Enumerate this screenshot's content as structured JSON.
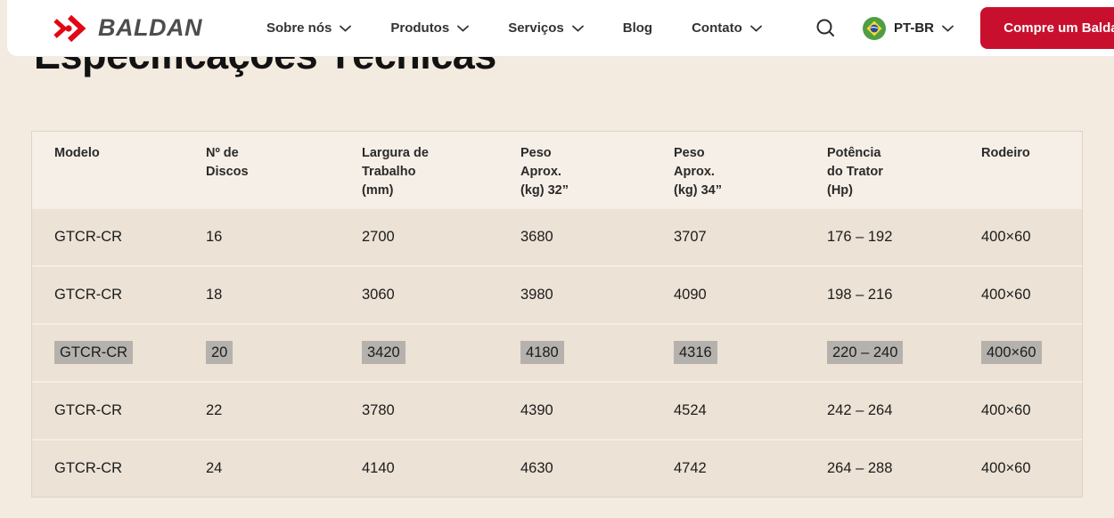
{
  "brand": {
    "name": "BALDAN"
  },
  "nav": {
    "items": [
      {
        "label": "Sobre nós",
        "has_dropdown": true
      },
      {
        "label": "Produtos",
        "has_dropdown": true
      },
      {
        "label": "Serviços",
        "has_dropdown": true
      },
      {
        "label": "Blog",
        "has_dropdown": false
      },
      {
        "label": "Contato",
        "has_dropdown": true
      }
    ]
  },
  "header_actions": {
    "language": "PT-BR",
    "cta_label": "Compre um Baldan"
  },
  "page": {
    "title": "Especificações Técnicas"
  },
  "table": {
    "headers": [
      "Modelo",
      "Nº de\nDiscos",
      "Largura de\nTrabalho\n(mm)",
      "Peso\nAprox.\n(kg) 32”",
      "Peso\nAprox.\n(kg) 34”",
      "Potência\ndo Trator\n(Hp)",
      "Rodeiro"
    ],
    "rows": [
      {
        "selected": false,
        "cells": [
          "GTCR-CR",
          "16",
          "2700",
          "3680",
          "3707",
          "176 – 192",
          "400×60"
        ]
      },
      {
        "selected": false,
        "cells": [
          "GTCR-CR",
          "18",
          "3060",
          "3980",
          "4090",
          "198 – 216",
          "400×60"
        ]
      },
      {
        "selected": true,
        "cells": [
          "GTCR-CR",
          "20",
          "3420",
          "4180",
          "4316",
          "220 – 240",
          "400×60"
        ]
      },
      {
        "selected": false,
        "cells": [
          "GTCR-CR",
          "22",
          "3780",
          "4390",
          "4524",
          "242 – 264",
          "400×60"
        ]
      },
      {
        "selected": false,
        "cells": [
          "GTCR-CR",
          "24",
          "4140",
          "4630",
          "4742",
          "264 – 288",
          "400×60"
        ]
      }
    ]
  },
  "colors": {
    "logo_red": "#e30613",
    "cta_red": "#c8102e",
    "page_beige": "#f3eae0",
    "row_beige": "#ece2d5",
    "selection_gray": "#b5b2ae"
  }
}
